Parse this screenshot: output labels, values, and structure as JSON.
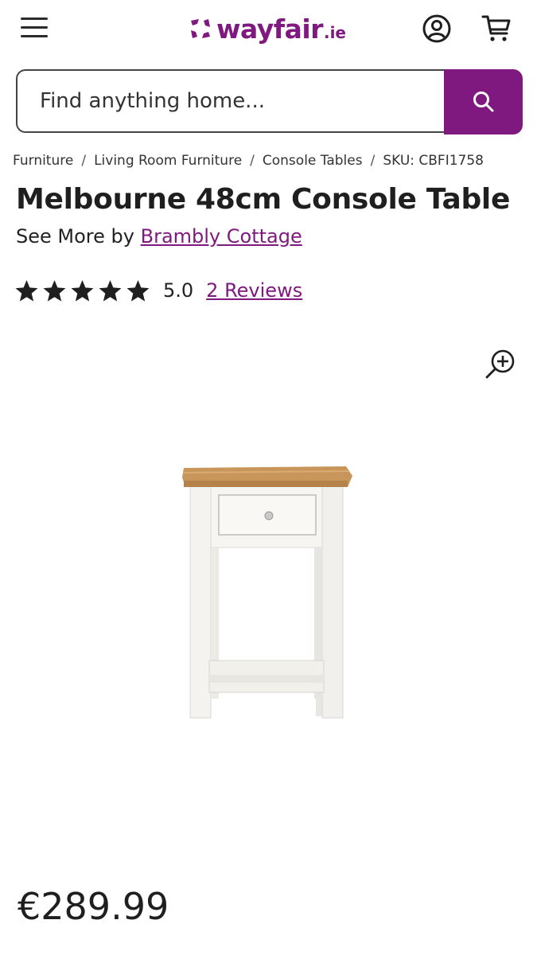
{
  "header": {
    "logo_text": "wayfair",
    "logo_tld": ".ie",
    "menu_icon": "hamburger-menu-icon",
    "account_icon": "account-icon",
    "cart_icon": "cart-icon"
  },
  "search": {
    "placeholder": "Find anything home...",
    "value": "",
    "button_icon": "search-icon"
  },
  "breadcrumb": {
    "items": [
      "Furniture",
      "Living Room Furniture",
      "Console Tables"
    ],
    "sku": "SKU: CBFI1758",
    "separator": "/"
  },
  "product": {
    "title": "Melbourne 48cm Console Table",
    "see_more_prefix": "See More by",
    "brand": "Brambly Cottage",
    "rating_value": "5.0",
    "stars_filled": 5,
    "stars_total": 5,
    "reviews_label": "2 Reviews",
    "price": "€289.99",
    "zoom_icon": "zoom-in-icon"
  },
  "colors": {
    "brand_purple": "#7f187f",
    "text_dark": "#1f1f1f",
    "border": "#444444",
    "table_top_wood": "#c8965a",
    "table_body": "#f4f3ef"
  }
}
